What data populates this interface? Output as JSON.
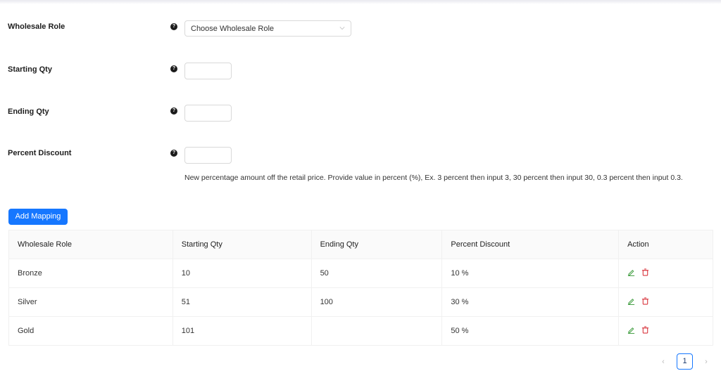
{
  "form": {
    "wholesale_role": {
      "label": "Wholesale Role",
      "placeholder": "Choose Wholesale Role",
      "help_icon": "question-circle-icon"
    },
    "starting_qty": {
      "label": "Starting Qty",
      "value": "",
      "help_icon": "question-circle-icon"
    },
    "ending_qty": {
      "label": "Ending Qty",
      "value": "",
      "help_icon": "question-circle-icon"
    },
    "percent_discount": {
      "label": "Percent Discount",
      "value": "",
      "help_icon": "question-circle-icon",
      "hint": "New percentage amount off the retail price. Provide value in percent (%), Ex. 3 percent then input 3, 30 percent then input 30, 0.3 percent then input 0.3."
    },
    "add_button": "Add Mapping"
  },
  "table": {
    "headers": [
      "Wholesale Role",
      "Starting Qty",
      "Ending Qty",
      "Percent Discount",
      "Action"
    ],
    "rows": [
      {
        "role": "Bronze",
        "start": "10",
        "end": "50",
        "discount": "10 %"
      },
      {
        "role": "Silver",
        "start": "51",
        "end": "100",
        "discount": "30 %"
      },
      {
        "role": "Gold",
        "start": "101",
        "end": "",
        "discount": "50 %"
      }
    ],
    "action_icons": [
      "edit-icon",
      "delete-icon"
    ]
  },
  "pagination": {
    "prev": "‹",
    "current_page": "1",
    "next": "›"
  },
  "colors": {
    "primary": "#1677ff",
    "edit": "#3a9a3a",
    "delete": "#d9363e"
  }
}
